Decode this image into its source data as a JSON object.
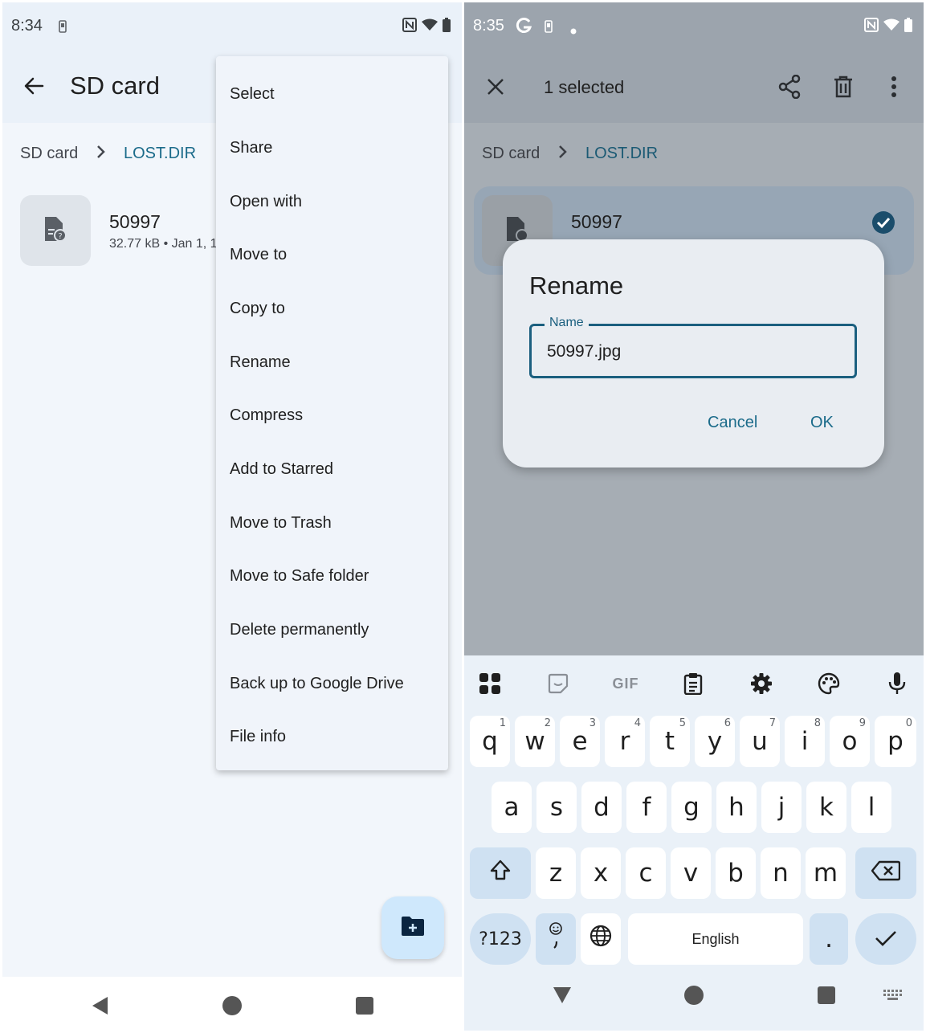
{
  "left": {
    "status": {
      "time": "8:34"
    },
    "appbar": {
      "title": "SD card"
    },
    "breadcrumb": {
      "root": "SD card",
      "current": "LOST.DIR"
    },
    "file": {
      "name": "50997",
      "meta": "32.77 kB • Jan 1, 1"
    },
    "menu": {
      "items": [
        "Select",
        "Share",
        "Open with",
        "Move to",
        "Copy to",
        "Rename",
        "Compress",
        "Add to Starred",
        "Move to Trash",
        "Move to Safe folder",
        "Delete permanently",
        "Back up to Google Drive",
        "File info"
      ]
    }
  },
  "right": {
    "status": {
      "time": "8:35"
    },
    "appbar": {
      "selection": "1 selected"
    },
    "breadcrumb": {
      "root": "SD card",
      "current": "LOST.DIR"
    },
    "file": {
      "name": "50997"
    },
    "dialog": {
      "title": "Rename",
      "field_label": "Name",
      "field_value": "50997.jpg",
      "cancel": "Cancel",
      "ok": "OK"
    },
    "keyboard": {
      "row1": [
        "q",
        "w",
        "e",
        "r",
        "t",
        "y",
        "u",
        "i",
        "o",
        "p"
      ],
      "row1_hints": [
        "1",
        "2",
        "3",
        "4",
        "5",
        "6",
        "7",
        "8",
        "9",
        "0"
      ],
      "row2": [
        "a",
        "s",
        "d",
        "f",
        "g",
        "h",
        "j",
        "k",
        "l"
      ],
      "row3": [
        "z",
        "x",
        "c",
        "v",
        "b",
        "n",
        "m"
      ],
      "symbols_key": "?123",
      "space_label": "English",
      "period_key": ".",
      "toolbar_gif": "GIF"
    }
  },
  "colors": {
    "accent": "#1b6b8a",
    "dialog_bg": "#e9edf2",
    "menu_bg": "#f0f4fa",
    "fab_bg": "#cfe8fc"
  }
}
